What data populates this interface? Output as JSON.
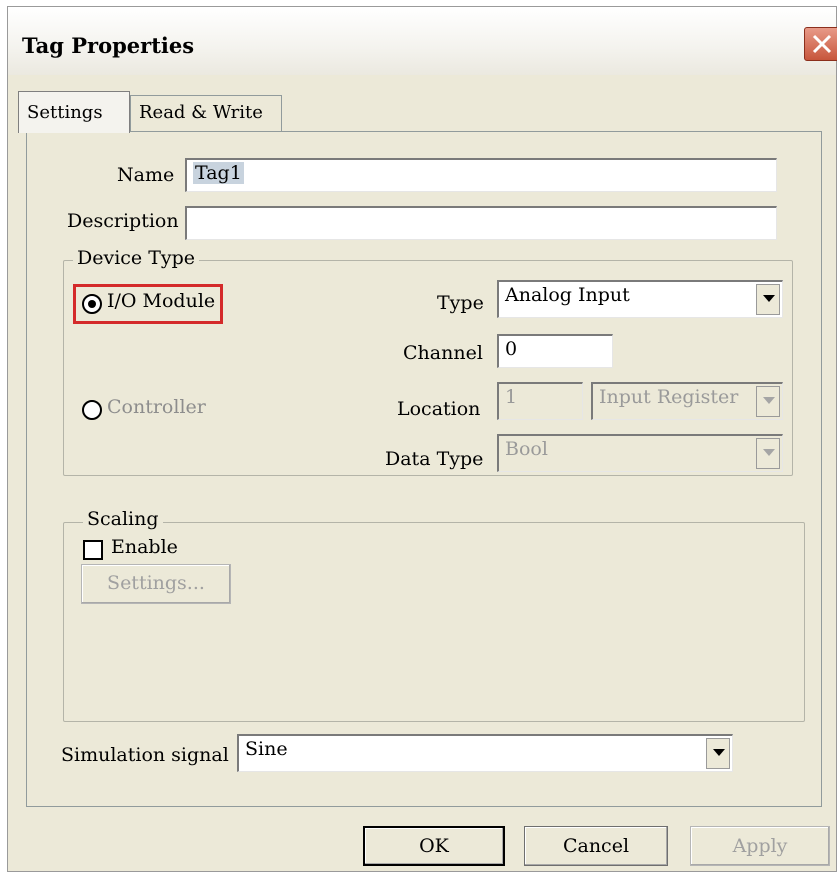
{
  "dialog": {
    "title": "Tag Properties"
  },
  "tabs": [
    {
      "label": "Settings"
    },
    {
      "label": "Read & Write"
    }
  ],
  "name": {
    "label": "Name",
    "value": "Tag1"
  },
  "description": {
    "label": "Description",
    "value": ""
  },
  "device_type": {
    "legend": "Device Type",
    "io_module": {
      "label": "I/O Module",
      "checked": true
    },
    "controller": {
      "label": "Controller",
      "checked": false
    },
    "type": {
      "label": "Type",
      "value": "Analog Input"
    },
    "channel": {
      "label": "Channel",
      "value": "0"
    },
    "location": {
      "label": "Location",
      "value": "1",
      "register": "Input Register"
    },
    "data_type": {
      "label": "Data Type",
      "value": "Bool"
    }
  },
  "scaling": {
    "legend": "Scaling",
    "enable_label": "Enable",
    "enabled": false,
    "settings_button": "Settings..."
  },
  "simulation": {
    "label": "Simulation signal",
    "value": "Sine"
  },
  "buttons": {
    "ok": "OK",
    "cancel": "Cancel",
    "apply": "Apply"
  },
  "colors": {
    "highlight": "#d42a2a",
    "dialog_bg": "#ece9d8"
  }
}
